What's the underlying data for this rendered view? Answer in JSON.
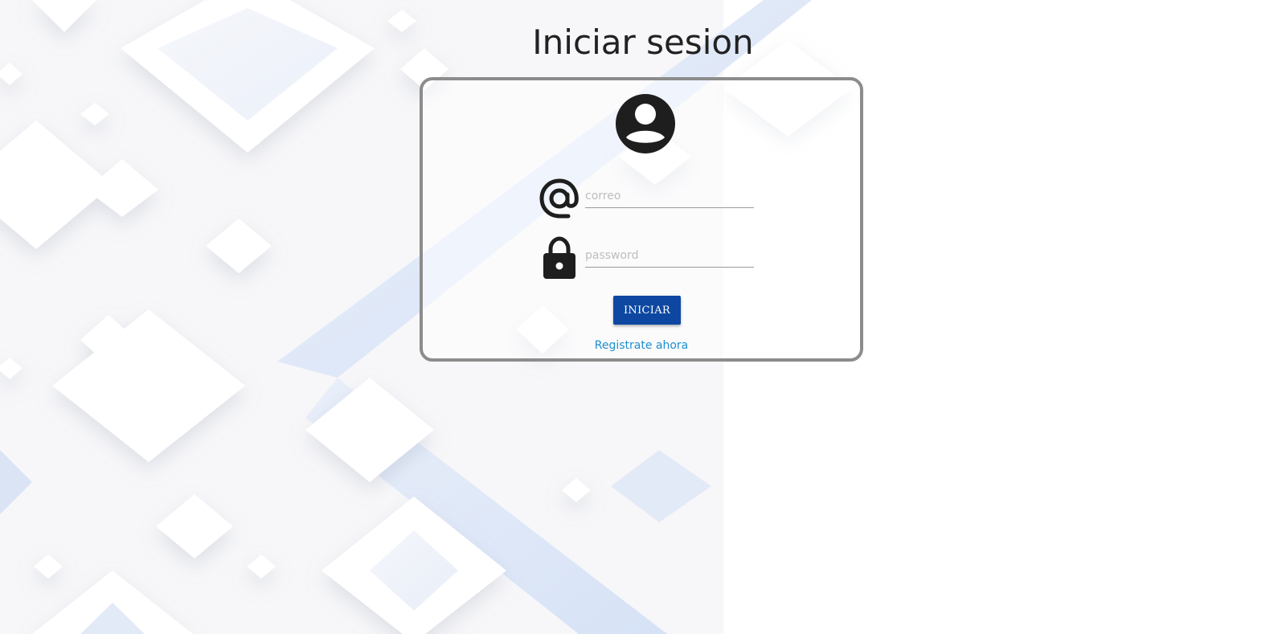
{
  "page": {
    "title": "Iniciar sesion"
  },
  "form": {
    "email_placeholder": "correo",
    "password_placeholder": "password",
    "submit_label": "INICIAR",
    "register_link": "Registrate ahora"
  },
  "icons": {
    "avatar": "account-circle-icon",
    "email": "at-sign-icon",
    "password": "lock-icon"
  },
  "colors": {
    "button_bg": "#0d47a1",
    "link": "#1f8fd0",
    "card_border": "#8c8c8c",
    "icon": "#1e1e1e"
  }
}
